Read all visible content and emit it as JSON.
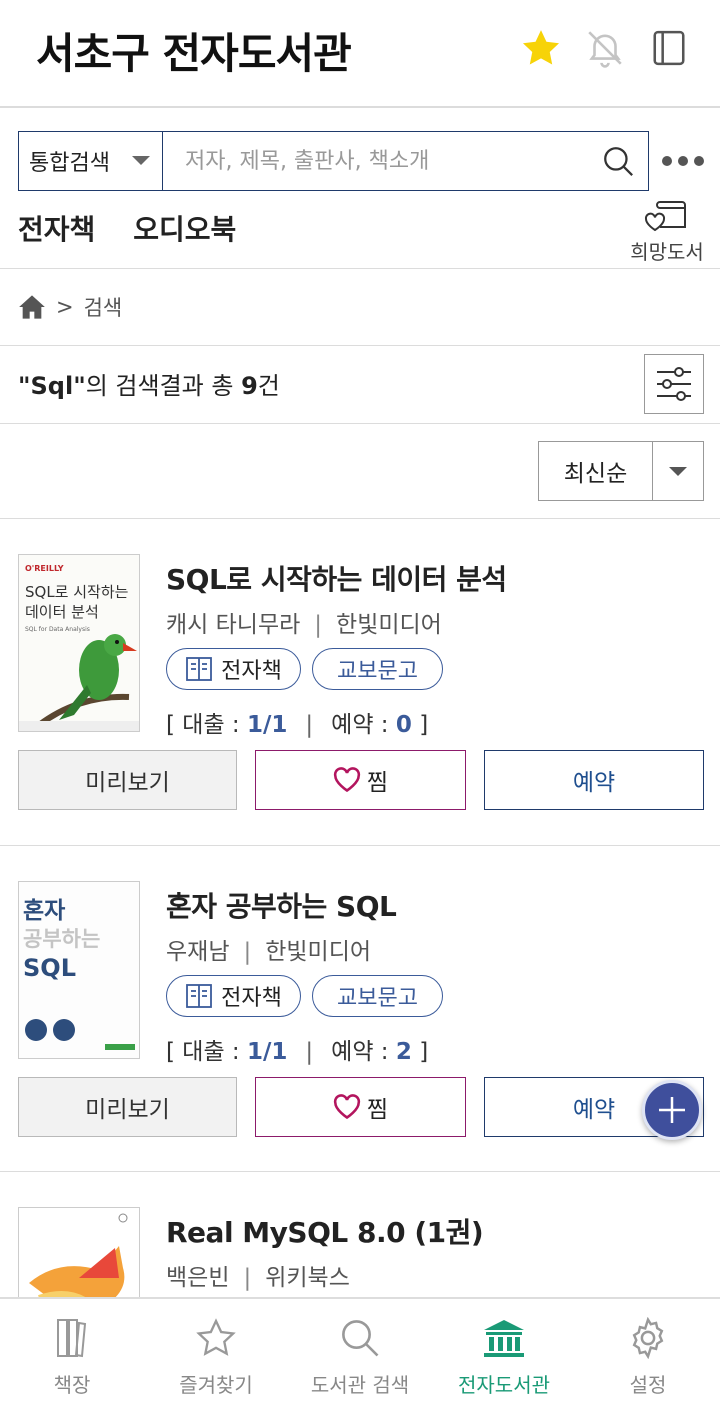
{
  "header": {
    "title": "서초구 전자도서관",
    "colors": {
      "star": "#f7d308",
      "icon": "#555555"
    }
  },
  "search": {
    "scope": "통합검색",
    "placeholder": "저자, 제목, 출판사, 책소개"
  },
  "tabs": [
    {
      "label": "전자책"
    },
    {
      "label": "오디오북"
    }
  ],
  "hope_book_label": "희망도서",
  "breadcrumb": {
    "separator": ">",
    "current": "검색"
  },
  "result": {
    "query": "\"Sql\"",
    "text_mid": "의 검색결과 총 ",
    "count": "9",
    "unit": "건"
  },
  "sort": {
    "selected": "최신순"
  },
  "books": [
    {
      "title": "SQL로 시작하는 데이터 분석",
      "author": "캐시 타니무라",
      "publisher": "한빛미디어",
      "chips": [
        "전자책",
        "교보문고"
      ],
      "loan_label": "대출 :",
      "loan_value": "1/1",
      "reserve_label": "예약 :",
      "reserve_value": "0",
      "buttons": {
        "preview": "미리보기",
        "wish": "찜",
        "reserve": "예약"
      },
      "cover": {
        "publisher_mark": "O'REILLY",
        "title_line1": "SQL로 시작하는",
        "title_line2": "데이터 분석",
        "subtitle": "SQL for Data Analysis"
      }
    },
    {
      "title": "혼자 공부하는 SQL",
      "author": "우재남",
      "publisher": "한빛미디어",
      "chips": [
        "전자책",
        "교보문고"
      ],
      "loan_label": "대출 :",
      "loan_value": "1/1",
      "reserve_label": "예약 :",
      "reserve_value": "2",
      "buttons": {
        "preview": "미리보기",
        "wish": "찜",
        "reserve": "예약"
      },
      "cover": {
        "line1": "혼자",
        "line2": "공부하는",
        "line3": "SQL"
      }
    },
    {
      "title": "Real MySQL 8.0 (1권)",
      "author": "백은빈",
      "publisher": "위키북스"
    }
  ],
  "bottom_nav": [
    {
      "label": "책장",
      "icon": "bookshelf-icon"
    },
    {
      "label": "즐겨찾기",
      "icon": "star-outline-icon"
    },
    {
      "label": "도서관 검색",
      "icon": "search-icon"
    },
    {
      "label": "전자도서관",
      "icon": "library-icon",
      "active": true
    },
    {
      "label": "설정",
      "icon": "gear-icon"
    }
  ],
  "colors": {
    "accent_navy": "#1f3a6b",
    "accent_blue": "#3b5b9a",
    "wish_border": "#8c1a6a",
    "active_green": "#1a9a76"
  }
}
